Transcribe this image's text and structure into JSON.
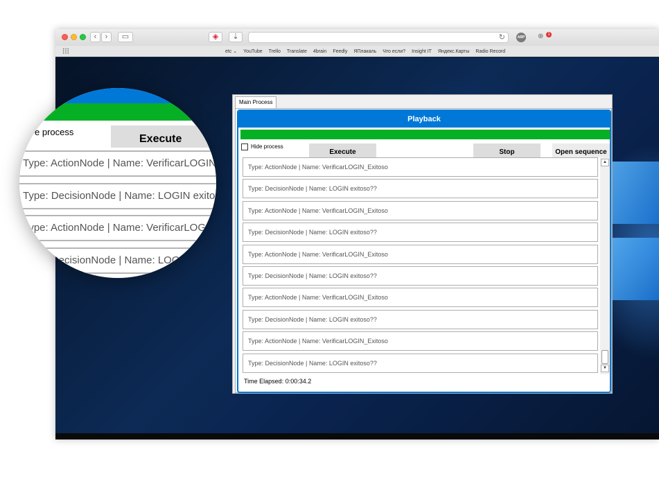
{
  "browser": {
    "bookmarks": [
      "etc ⌄",
      "YouTube",
      "Trello",
      "Translate",
      "4brain",
      "Feedly",
      "ЯПлакаль",
      "Что если?",
      "Insight IT",
      "Яндекс.Карты",
      "Radio Record"
    ],
    "notification_count": "1"
  },
  "app": {
    "tab_label": "Main Process",
    "header_title": "Playback",
    "progress_percent": 100,
    "progress_color": "#06b025",
    "accent_color": "#0078d7",
    "hide_process_label": "Hide process",
    "hide_process_checked": false,
    "execute_label": "Execute",
    "stop_label": "Stop",
    "open_sequence_label": "Open sequence",
    "rows": [
      "Type: ActionNode | Name: VerificarLOGIN_Exitoso",
      "Type: DecisionNode | Name: LOGIN exitoso??",
      "Type: ActionNode | Name: VerificarLOGIN_Exitoso",
      "Type: DecisionNode | Name: LOGIN exitoso??",
      "Type: ActionNode | Name: VerificarLOGIN_Exitoso",
      "Type: DecisionNode | Name: LOGIN exitoso??",
      "Type: ActionNode | Name: VerificarLOGIN_Exitoso",
      "Type: DecisionNode | Name: LOGIN exitoso??",
      "Type: ActionNode | Name: VerificarLOGIN_Exitoso",
      "Type: DecisionNode | Name: LOGIN exitoso??"
    ],
    "time_elapsed": "Time Elapsed: 0:00:34.2"
  },
  "magnifier": {
    "hide_text": "e process",
    "execute_label": "Execute",
    "rows": [
      "Type: ActionNode | Name: VerificarLOGIN_Exitoso",
      "Type: DecisionNode | Name: LOGIN exitoso??",
      "Type: ActionNode | Name: VerificarLOGIN_Exitoso",
      "Type: DecisionNode | Name: LOGIN exitoso??"
    ]
  }
}
